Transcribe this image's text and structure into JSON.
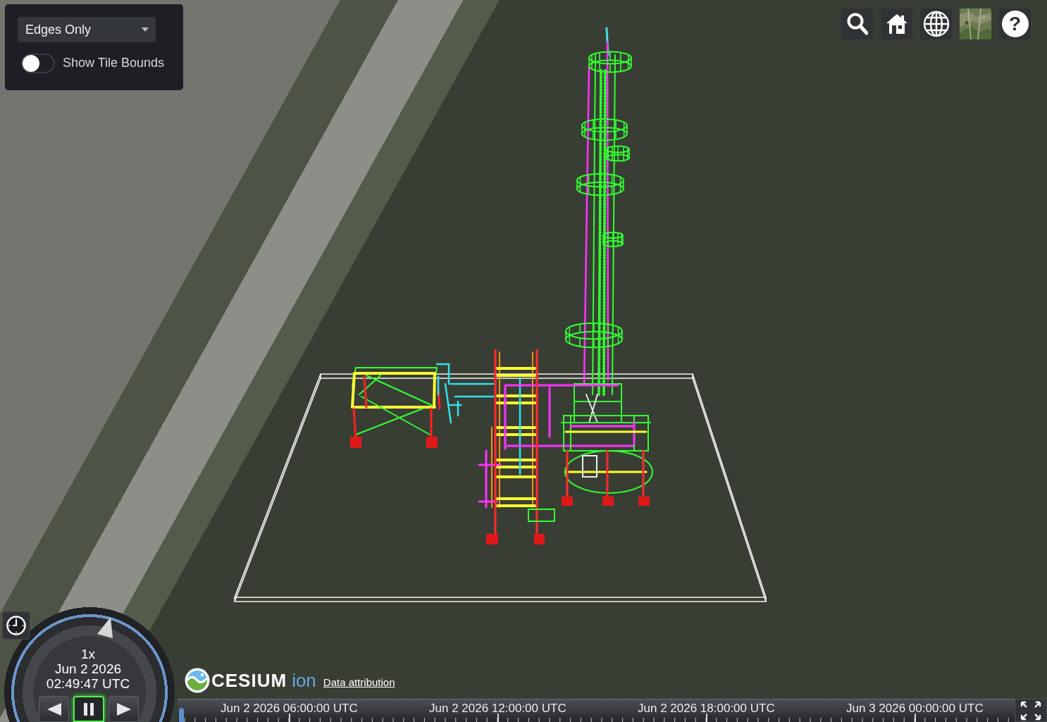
{
  "settings_panel": {
    "dropdown": {
      "value": "Edges Only"
    },
    "toggle": {
      "label": "Show Tile Bounds",
      "on": false
    }
  },
  "toolbar": {
    "buttons": [
      {
        "kind": "search"
      },
      {
        "kind": "home"
      },
      {
        "kind": "globe"
      },
      {
        "kind": "imagery"
      },
      {
        "kind": "help",
        "label": "?"
      }
    ]
  },
  "animation": {
    "speed": "1x",
    "date": "Jun 2 2026",
    "time": "02:49:47 UTC",
    "buttons": [
      {
        "kind": "reverse",
        "selected": false
      },
      {
        "kind": "pause",
        "selected": true
      },
      {
        "kind": "play",
        "selected": false
      }
    ]
  },
  "credits": {
    "logo_text": "CESIUM",
    "logo_suffix": "ion",
    "link": "Data attribution"
  },
  "timeline": {
    "labels": [
      "Jun 2 2026 06:00:00 UTC",
      "Jun 2 2026 12:00:00 UTC",
      "Jun 2 2026 18:00:00 UTC",
      "Jun 3 2026 00:00:00 UTC"
    ]
  }
}
